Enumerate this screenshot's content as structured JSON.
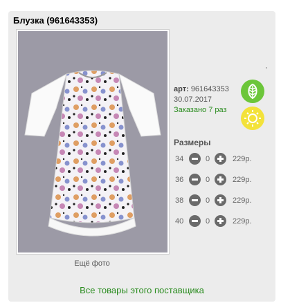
{
  "product": {
    "title": "Блузка (961643353)",
    "art_label": "арт:",
    "art_value": "961643353",
    "date": "30.07.2017",
    "ordered": "Заказано 7 раз",
    "more_photo": "Ещё фото",
    "corner_mark": "'"
  },
  "badges": [
    {
      "icon": "leaf-icon",
      "color": "#6cc63a"
    },
    {
      "icon": "sun-icon",
      "color": "#f3e23a"
    }
  ],
  "sizes": {
    "title": "Размеры",
    "rows": [
      {
        "size": "34",
        "qty": "0",
        "price": "229р."
      },
      {
        "size": "36",
        "qty": "0",
        "price": "229р."
      },
      {
        "size": "38",
        "qty": "0",
        "price": "229р."
      },
      {
        "size": "40",
        "qty": "0",
        "price": "229р."
      }
    ]
  },
  "footer": {
    "supplier_link": "Все товары этого поставщика"
  },
  "colors": {
    "accent_green": "#2a8c1f",
    "card_bg": "#ececec",
    "photo_bg": "#9c9aa6"
  }
}
